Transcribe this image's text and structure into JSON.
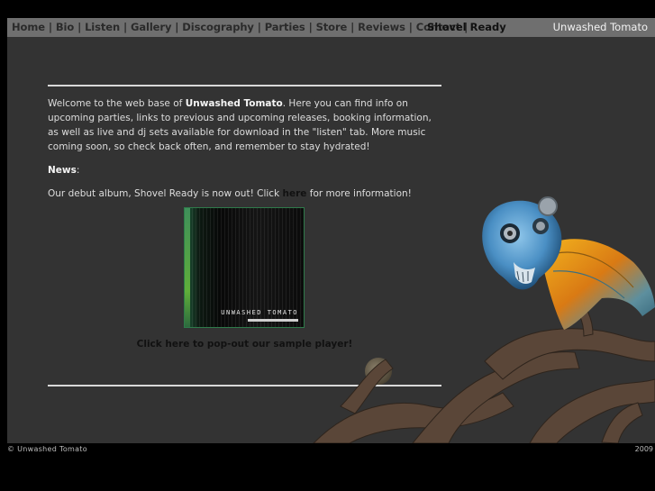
{
  "nav": {
    "items": [
      {
        "label": "Home"
      },
      {
        "label": "Bio"
      },
      {
        "label": "Listen"
      },
      {
        "label": "Gallery"
      },
      {
        "label": "Discography"
      },
      {
        "label": "Parties"
      },
      {
        "label": "Store"
      },
      {
        "label": "Reviews"
      },
      {
        "label": "Contact"
      }
    ],
    "separator": "|",
    "album_title": "Shovel Ready",
    "brand": "Unwashed Tomato"
  },
  "content": {
    "intro_before": "Welcome to the web base of ",
    "intro_brand": "Unwashed Tomato",
    "intro_after": ". Here you can find info on upcoming parties, links to previous and upcoming releases, booking information, as well as live and dj sets available for download in the \"listen\" tab. More music coming soon, so check back often, and remember to stay hydrated!",
    "news_label": "News",
    "news_colon": ":",
    "news_before": "Our debut album, Shovel Ready is now out! Click ",
    "news_link": "here",
    "news_after": " for more information!",
    "cover_text": "Unwashed Tomato",
    "player_link": "Click here to pop-out our sample player!"
  },
  "footer": {
    "copyright": "© Unwashed Tomato",
    "year": "2009"
  },
  "colors": {
    "background": "#333333",
    "navbar": "#6f6f6f",
    "rule": "#d9d9d9"
  }
}
